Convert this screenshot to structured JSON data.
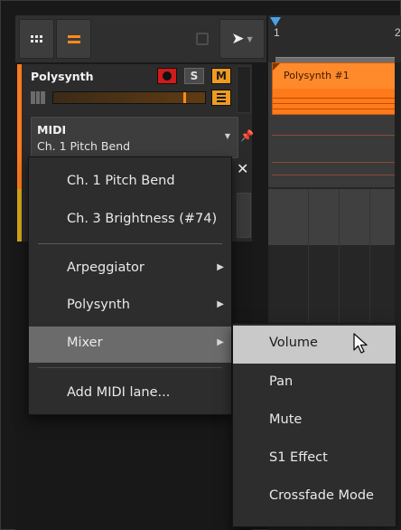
{
  "toolbar": {
    "buttons": [
      "grid",
      "lines",
      "dim",
      "pointer"
    ]
  },
  "timeline": {
    "ruler_numbers": [
      "1",
      "2"
    ]
  },
  "track": {
    "name": "Polysynth",
    "solo_label": "S",
    "mute_label": "M",
    "volume_level": 0.86
  },
  "midi_selector": {
    "title": "MIDI",
    "value": "Ch. 1 Pitch Bend"
  },
  "clip": {
    "name": "Polysynth #1"
  },
  "menu": {
    "items": [
      {
        "label": "Ch. 1 Pitch Bend"
      },
      {
        "label": "Ch. 3 Brightness (#74)"
      },
      {
        "label": "Arpeggiator"
      },
      {
        "label": "Polysynth"
      },
      {
        "label": "Mixer"
      },
      {
        "label": "Add MIDI lane..."
      }
    ]
  },
  "submenu": {
    "items": [
      {
        "label": "Volume"
      },
      {
        "label": "Pan"
      },
      {
        "label": "Mute"
      },
      {
        "label": "S1 Effect"
      },
      {
        "label": "Crossfade Mode"
      }
    ]
  },
  "colors": {
    "accent": "#ff7a1a",
    "record": "#d11a1a",
    "mute": "#f09a1f",
    "play_marker": "#4aa3e8",
    "highlight": "#6b6b6b",
    "submenu_highlight": "#c9c9c9"
  }
}
